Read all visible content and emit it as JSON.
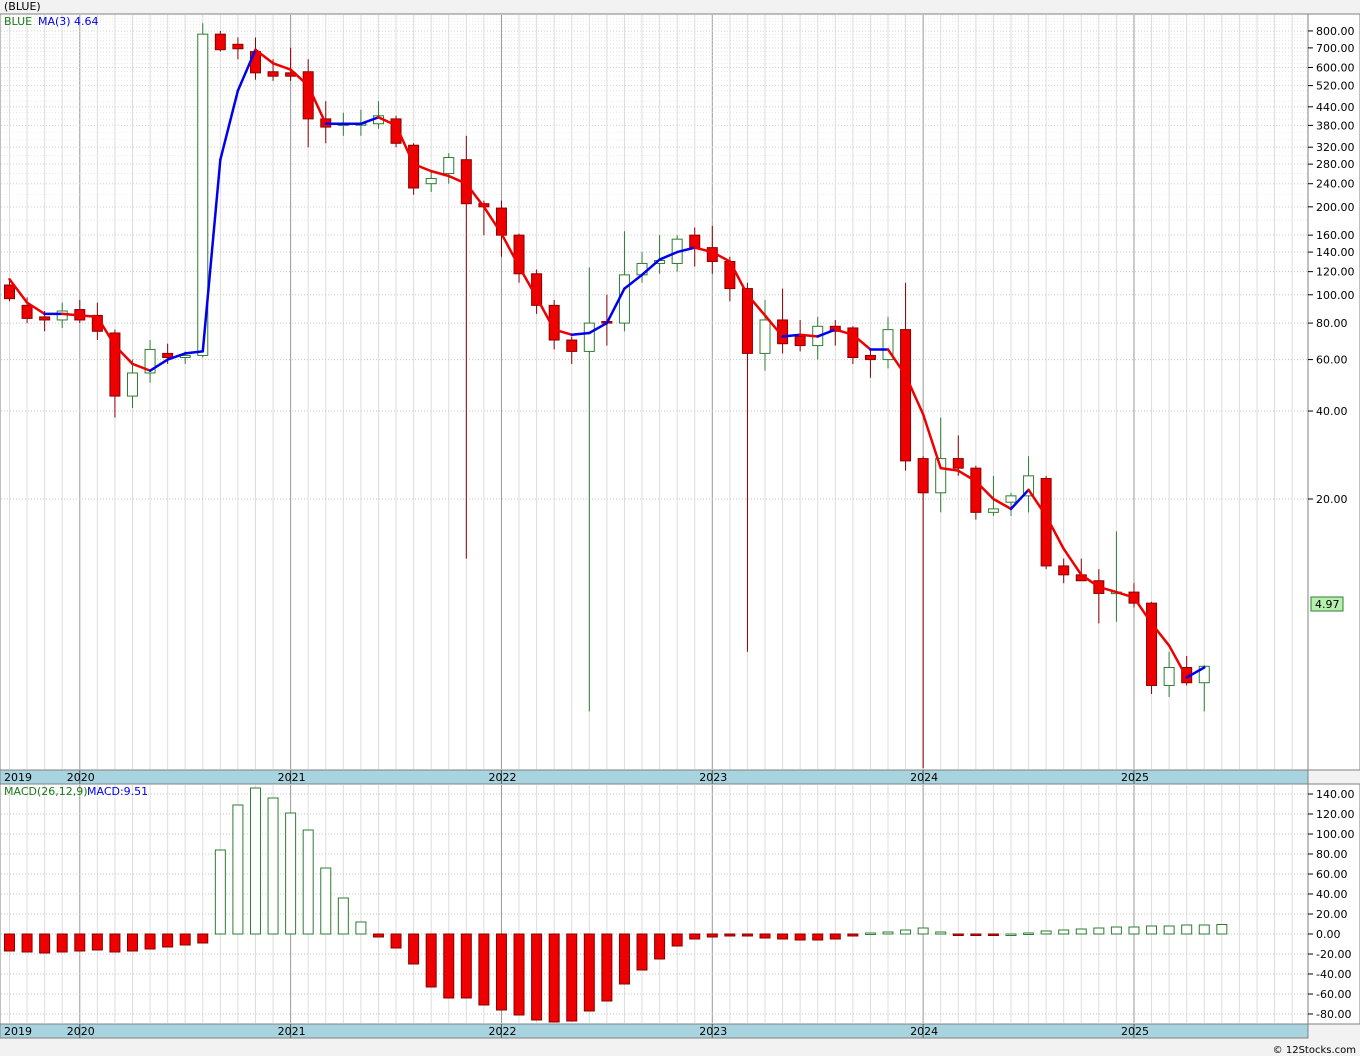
{
  "header": {
    "title": "(BLUE)"
  },
  "footer": {
    "credit": "© 12Stocks.com"
  },
  "colors": {
    "up": "#2e7d32",
    "down": "#ee0000",
    "ma_up": "#0000ee",
    "ma_down": "#ee0000",
    "grid": "#bbbbbb",
    "axis_band": "#a8d4e0"
  },
  "chart_data": [
    {
      "type": "candlestick",
      "panel": "price",
      "legend": {
        "symbol": "BLUE",
        "ma_label": "MA(3)",
        "ma_value": "4.64"
      },
      "last_price_label": "4.97",
      "y_scale": "log",
      "ylim": [
        2.4,
        900
      ],
      "y_ticks": [
        800,
        700,
        600,
        520,
        440,
        380,
        320,
        280,
        240,
        200,
        160,
        140,
        120,
        100,
        80,
        60,
        40,
        20
      ],
      "y_tick_labels": [
        "800.00",
        "700.00",
        "600.00",
        "520.00",
        "440.00",
        "380.00",
        "320.00",
        "280.00",
        "240.00",
        "200.00",
        "160.00",
        "140.00",
        "120.00",
        "100.00",
        "80.00",
        "60.00",
        "40.00",
        "20.00"
      ],
      "x_labels": [
        "2019",
        "2020",
        "2021",
        "2022",
        "2023",
        "2024",
        "2025"
      ],
      "x_label_months": [
        0,
        4,
        16,
        28,
        40,
        52,
        64
      ],
      "candles": [
        {
          "m": 0,
          "o": 108,
          "h": 113,
          "l": 95,
          "c": 97
        },
        {
          "m": 1,
          "o": 92,
          "h": 98,
          "l": 80,
          "c": 83
        },
        {
          "m": 2,
          "o": 84,
          "h": 88,
          "l": 75,
          "c": 82
        },
        {
          "m": 3,
          "o": 82,
          "h": 94,
          "l": 77,
          "c": 88
        },
        {
          "m": 4,
          "o": 89,
          "h": 96,
          "l": 80,
          "c": 82
        },
        {
          "m": 5,
          "o": 85,
          "h": 94,
          "l": 70,
          "c": 75
        },
        {
          "m": 6,
          "o": 74,
          "h": 76,
          "l": 38,
          "c": 45
        },
        {
          "m": 7,
          "o": 45,
          "h": 60,
          "l": 41,
          "c": 54
        },
        {
          "m": 8,
          "o": 54,
          "h": 70,
          "l": 50,
          "c": 65
        },
        {
          "m": 9,
          "o": 63,
          "h": 68,
          "l": 58,
          "c": 61
        },
        {
          "m": 10,
          "o": 61,
          "h": 64,
          "l": 58,
          "c": 62
        },
        {
          "m": 11,
          "o": 62,
          "h": 850,
          "l": 61,
          "c": 780
        },
        {
          "m": 12,
          "o": 780,
          "h": 800,
          "l": 680,
          "c": 690
        },
        {
          "m": 13,
          "o": 720,
          "h": 760,
          "l": 640,
          "c": 695
        },
        {
          "m": 14,
          "o": 680,
          "h": 760,
          "l": 545,
          "c": 575
        },
        {
          "m": 15,
          "o": 580,
          "h": 640,
          "l": 540,
          "c": 560
        },
        {
          "m": 16,
          "o": 575,
          "h": 700,
          "l": 540,
          "c": 560
        },
        {
          "m": 17,
          "o": 580,
          "h": 640,
          "l": 320,
          "c": 400
        },
        {
          "m": 18,
          "o": 400,
          "h": 460,
          "l": 330,
          "c": 375
        },
        {
          "m": 19,
          "o": 380,
          "h": 420,
          "l": 350,
          "c": 385
        },
        {
          "m": 20,
          "o": 385,
          "h": 430,
          "l": 350,
          "c": 385
        },
        {
          "m": 21,
          "o": 385,
          "h": 460,
          "l": 370,
          "c": 410
        },
        {
          "m": 22,
          "o": 400,
          "h": 410,
          "l": 320,
          "c": 330
        },
        {
          "m": 23,
          "o": 325,
          "h": 330,
          "l": 220,
          "c": 232
        },
        {
          "m": 24,
          "o": 240,
          "h": 265,
          "l": 225,
          "c": 250
        },
        {
          "m": 25,
          "o": 260,
          "h": 305,
          "l": 240,
          "c": 295
        },
        {
          "m": 26,
          "o": 290,
          "h": 350,
          "l": 12.5,
          "c": 205
        },
        {
          "m": 27,
          "o": 205,
          "h": 210,
          "l": 160,
          "c": 200
        },
        {
          "m": 28,
          "o": 198,
          "h": 210,
          "l": 135,
          "c": 160
        },
        {
          "m": 29,
          "o": 160,
          "h": 162,
          "l": 110,
          "c": 118
        },
        {
          "m": 30,
          "o": 118,
          "h": 122,
          "l": 86,
          "c": 92
        },
        {
          "m": 31,
          "o": 92,
          "h": 96,
          "l": 65,
          "c": 70
        },
        {
          "m": 32,
          "o": 70,
          "h": 72,
          "l": 58,
          "c": 64
        },
        {
          "m": 33,
          "o": 64,
          "h": 124,
          "l": 3.75,
          "c": 80
        },
        {
          "m": 34,
          "o": 81,
          "h": 100,
          "l": 67,
          "c": 80
        },
        {
          "m": 35,
          "o": 80,
          "h": 165,
          "l": 75,
          "c": 117
        },
        {
          "m": 36,
          "o": 117,
          "h": 140,
          "l": 110,
          "c": 128
        },
        {
          "m": 37,
          "o": 128,
          "h": 160,
          "l": 118,
          "c": 131
        },
        {
          "m": 38,
          "o": 128,
          "h": 160,
          "l": 120,
          "c": 155
        },
        {
          "m": 39,
          "o": 160,
          "h": 170,
          "l": 125,
          "c": 145
        },
        {
          "m": 40,
          "o": 145,
          "h": 172,
          "l": 118,
          "c": 130
        },
        {
          "m": 41,
          "o": 130,
          "h": 135,
          "l": 95,
          "c": 105
        },
        {
          "m": 42,
          "o": 105,
          "h": 110,
          "l": 6.0,
          "c": 63
        },
        {
          "m": 43,
          "o": 63,
          "h": 96,
          "l": 55,
          "c": 82
        },
        {
          "m": 44,
          "o": 82,
          "h": 105,
          "l": 63,
          "c": 68
        },
        {
          "m": 45,
          "o": 72,
          "h": 82,
          "l": 64,
          "c": 67
        },
        {
          "m": 46,
          "o": 67,
          "h": 84,
          "l": 60,
          "c": 78
        },
        {
          "m": 47,
          "o": 78,
          "h": 82,
          "l": 67,
          "c": 75
        },
        {
          "m": 48,
          "o": 77,
          "h": 78,
          "l": 58,
          "c": 61
        },
        {
          "m": 49,
          "o": 62,
          "h": 65,
          "l": 52,
          "c": 60
        },
        {
          "m": 50,
          "o": 60,
          "h": 84,
          "l": 56,
          "c": 76
        },
        {
          "m": 51,
          "o": 76,
          "h": 110,
          "l": 25,
          "c": 27
        },
        {
          "m": 52,
          "o": 27.5,
          "h": 28,
          "l": 2.4,
          "c": 21
        },
        {
          "m": 53,
          "o": 21,
          "h": 38,
          "l": 18,
          "c": 27.5
        },
        {
          "m": 54,
          "o": 27.5,
          "h": 33,
          "l": 24,
          "c": 25.5
        },
        {
          "m": 55,
          "o": 25.5,
          "h": 26,
          "l": 17,
          "c": 18
        },
        {
          "m": 56,
          "o": 18,
          "h": 24,
          "l": 17.5,
          "c": 18.5
        },
        {
          "m": 57,
          "o": 19.5,
          "h": 21,
          "l": 17.5,
          "c": 20.5
        },
        {
          "m": 58,
          "o": 20.5,
          "h": 28,
          "l": 18,
          "c": 24
        },
        {
          "m": 59,
          "o": 23.5,
          "h": 24,
          "l": 11.5,
          "c": 11.8
        },
        {
          "m": 60,
          "o": 11.8,
          "h": 12.5,
          "l": 10.3,
          "c": 11
        },
        {
          "m": 61,
          "o": 11,
          "h": 12.5,
          "l": 10.5,
          "c": 10.5
        },
        {
          "m": 62,
          "o": 10.5,
          "h": 11.5,
          "l": 7.5,
          "c": 9.5
        },
        {
          "m": 63,
          "o": 9.5,
          "h": 15.5,
          "l": 7.6,
          "c": 9.6
        },
        {
          "m": 64,
          "o": 9.6,
          "h": 10.3,
          "l": 8.5,
          "c": 8.8
        },
        {
          "m": 65,
          "o": 8.8,
          "h": 8.9,
          "l": 4.3,
          "c": 4.6
        },
        {
          "m": 66,
          "o": 4.6,
          "h": 6.0,
          "l": 4.2,
          "c": 5.3
        },
        {
          "m": 67,
          "o": 5.3,
          "h": 5.8,
          "l": 4.6,
          "c": 4.7
        },
        {
          "m": 68,
          "o": 4.7,
          "h": 5.4,
          "l": 3.75,
          "c": 5.35
        }
      ],
      "ma3": [
        113,
        94,
        86,
        86,
        85,
        84,
        67,
        58,
        55,
        60,
        63,
        64,
        290,
        500,
        690,
        620,
        590,
        520,
        385,
        385,
        385,
        405,
        380,
        280,
        265,
        255,
        240,
        200,
        162,
        125,
        98,
        76,
        73,
        74,
        80,
        105,
        117,
        132,
        140,
        145,
        140,
        130,
        100,
        85,
        72,
        73,
        72,
        76,
        73,
        65,
        65,
        53,
        39,
        25.5,
        25,
        23,
        20,
        18.5,
        21.5,
        17.5,
        13.5,
        11,
        10,
        9.6,
        9.2,
        7.5,
        6.3,
        4.9,
        5.3
      ]
    },
    {
      "type": "bar",
      "panel": "macd",
      "legend": {
        "indicator": "MACD(26,12,9)",
        "value_label": "MACD:9.51"
      },
      "ylim": [
        -88,
        148
      ],
      "y_ticks": [
        140,
        120,
        100,
        80,
        60,
        40,
        20,
        0,
        -20,
        -40,
        -60,
        -80
      ],
      "y_tick_labels": [
        "140.00",
        "120.00",
        "100.00",
        "80.00",
        "60.00",
        "40.00",
        "20.00",
        "0.00",
        "-20.00",
        "-40.00",
        "-60.00",
        "-80.00"
      ],
      "x_labels": [
        "2019",
        "2020",
        "2021",
        "2022",
        "2023",
        "2024",
        "2025"
      ],
      "values": [
        -17,
        -18,
        -19,
        -18,
        -17,
        -16,
        -18,
        -17,
        -15,
        -13,
        -11,
        -9,
        84,
        129,
        146,
        136,
        121,
        104,
        66,
        36,
        12,
        -3,
        -14,
        -30,
        -53,
        -64,
        -64,
        -71,
        -76,
        -81,
        -86,
        -88,
        -87,
        -77,
        -67,
        -50,
        -36,
        -25,
        -12,
        -5,
        -3,
        -2,
        -2,
        -4,
        -5,
        -6,
        -6,
        -5,
        -2,
        1,
        2,
        4,
        6,
        2,
        -1,
        -1,
        -1,
        0,
        1,
        3,
        4,
        5,
        6,
        7,
        7,
        8,
        8,
        9,
        9,
        9.5
      ]
    }
  ]
}
